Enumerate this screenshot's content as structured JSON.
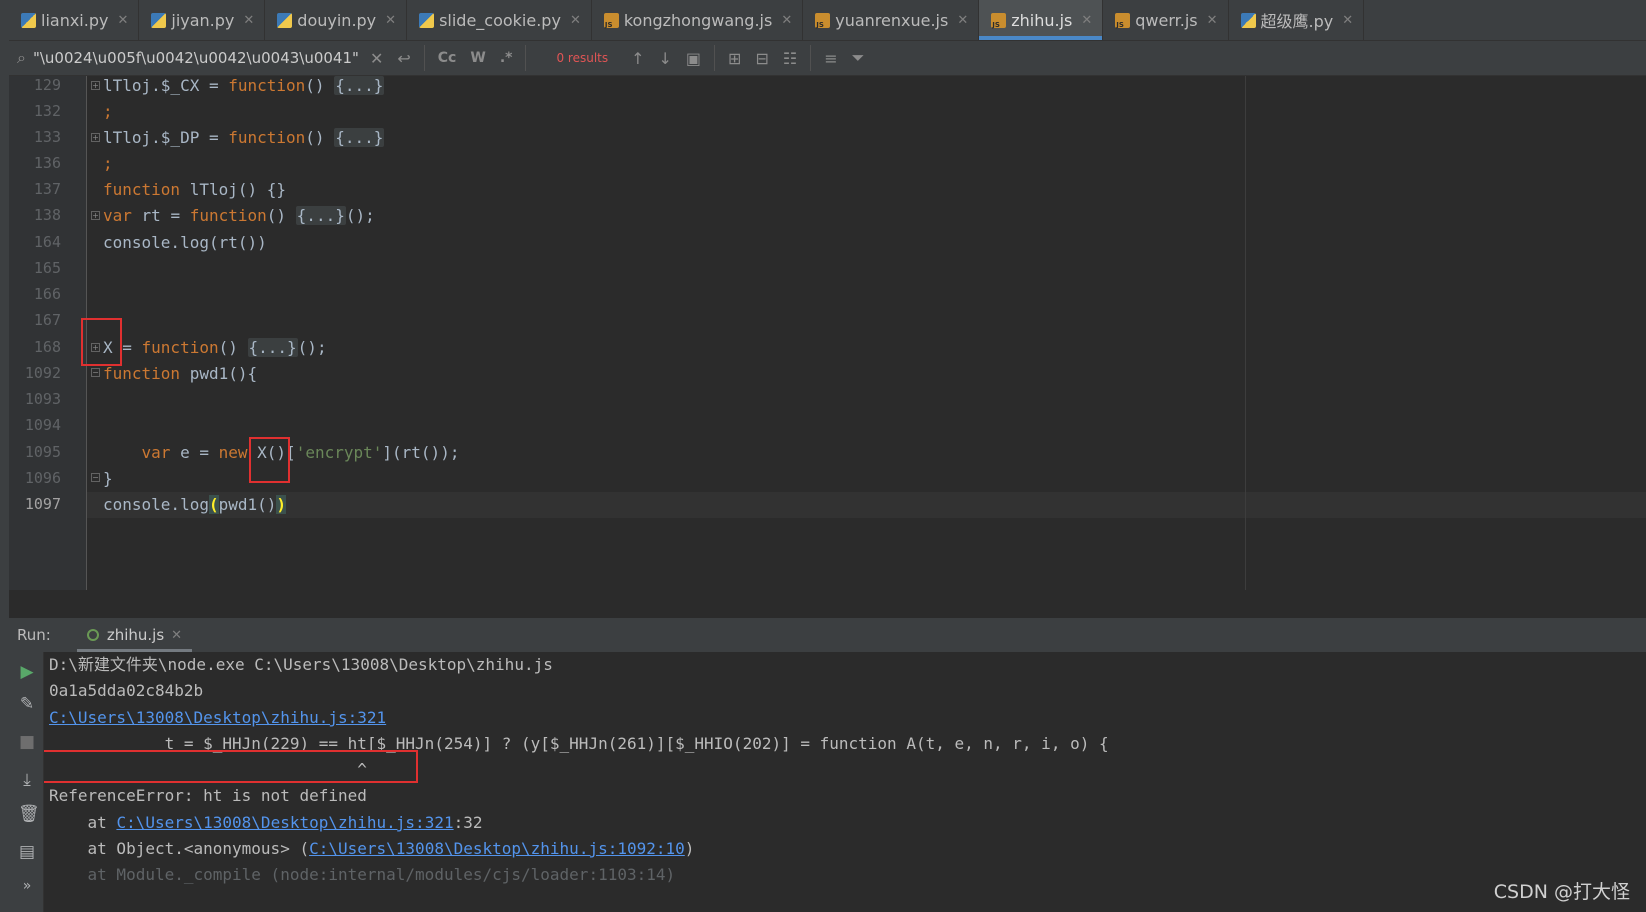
{
  "tabs": [
    {
      "label": "lianxi.py",
      "type": "py"
    },
    {
      "label": "jiyan.py",
      "type": "py"
    },
    {
      "label": "douyin.py",
      "type": "py"
    },
    {
      "label": "slide_cookie.py",
      "type": "py"
    },
    {
      "label": "kongzhongwang.js",
      "type": "js"
    },
    {
      "label": "yuanrenxue.js",
      "type": "js"
    },
    {
      "label": "zhihu.js",
      "type": "js",
      "active": true
    },
    {
      "label": "qwerr.js",
      "type": "js"
    },
    {
      "label": "超级鹰.py",
      "type": "py"
    }
  ],
  "search": {
    "query": "\"\\u0024\\u005f\\u0042\\u0042\\u0043\\u0041\"",
    "results": "0 results",
    "toggles": [
      "Cc",
      "W",
      ".*"
    ]
  },
  "editor": {
    "line_numbers": [
      "129",
      "132",
      "133",
      "136",
      "137",
      "138",
      "164",
      "165",
      "166",
      "167",
      "168",
      "1092",
      "1093",
      "1094",
      "1095",
      "1096",
      "1097"
    ],
    "current_line": "1097",
    "code": {
      "l129_a": "lTloj.$_CX = ",
      "l129_kw": "function",
      "l129_b": "() ",
      "l129_fold": "{...}",
      "l132": ";",
      "l133_a": "lTloj.$_DP = ",
      "l133_kw": "function",
      "l133_b": "() ",
      "l133_fold": "{...}",
      "l136": ";",
      "l137_kw": "function",
      "l137_b": " lTloj() {}",
      "l138_kw1": "var",
      "l138_a": " rt = ",
      "l138_kw2": "function",
      "l138_b": "() ",
      "l138_fold": "{...}",
      "l138_c": "();",
      "l164": "console.log(rt())",
      "l168_a": "X = ",
      "l168_kw": "function",
      "l168_b": "() ",
      "l168_fold": "{...}",
      "l168_c": "();",
      "l1092_kw": "function",
      "l1092_b": " pwd1(){",
      "l1095_kw1": "var",
      "l1095_a": " e = ",
      "l1095_kw2": "new",
      "l1095_b": " X()[",
      "l1095_str": "'encrypt'",
      "l1095_c": "](rt());",
      "l1096": "}",
      "l1097_a": "console.log",
      "l1097_p1": "(",
      "l1097_b": "pwd1()",
      "l1097_p2": ")"
    }
  },
  "run": {
    "label": "Run:",
    "tab": "zhihu.js",
    "console": {
      "cmd": "D:\\新建文件夹\\node.exe C:\\Users\\13008\\Desktop\\zhihu.js",
      "out1": "0a1a5dda02c84b2b",
      "link1": "C:\\Users\\13008\\Desktop\\zhihu.js:321",
      "src": "            t = $_HHJn(229) == ht[$_HHJn(254)] ? (y[$_HHJn(261)][$_HHIO(202)] = function A(t, e, n, r, i, o) {",
      "caret": "                                ^",
      "error": "ReferenceError: ht is not defined",
      "at1_pre": "    at ",
      "at1_link": "C:\\Users\\13008\\Desktop\\zhihu.js:321",
      "at1_post": ":32",
      "at2_pre": "    at Object.<anonymous> (",
      "at2_link": "C:\\Users\\13008\\Desktop\\zhihu.js:1092:10",
      "at2_post": ")",
      "at3": "    at Module._compile (node:internal/modules/cjs/loader:1103:14)"
    }
  },
  "watermark": "CSDN @打大怪",
  "colors": {
    "keyword": "#cc7832",
    "string": "#6a8759",
    "link": "#5394ec",
    "highlight_box": "#e03030",
    "active_tab_underline": "#4a88c7"
  }
}
